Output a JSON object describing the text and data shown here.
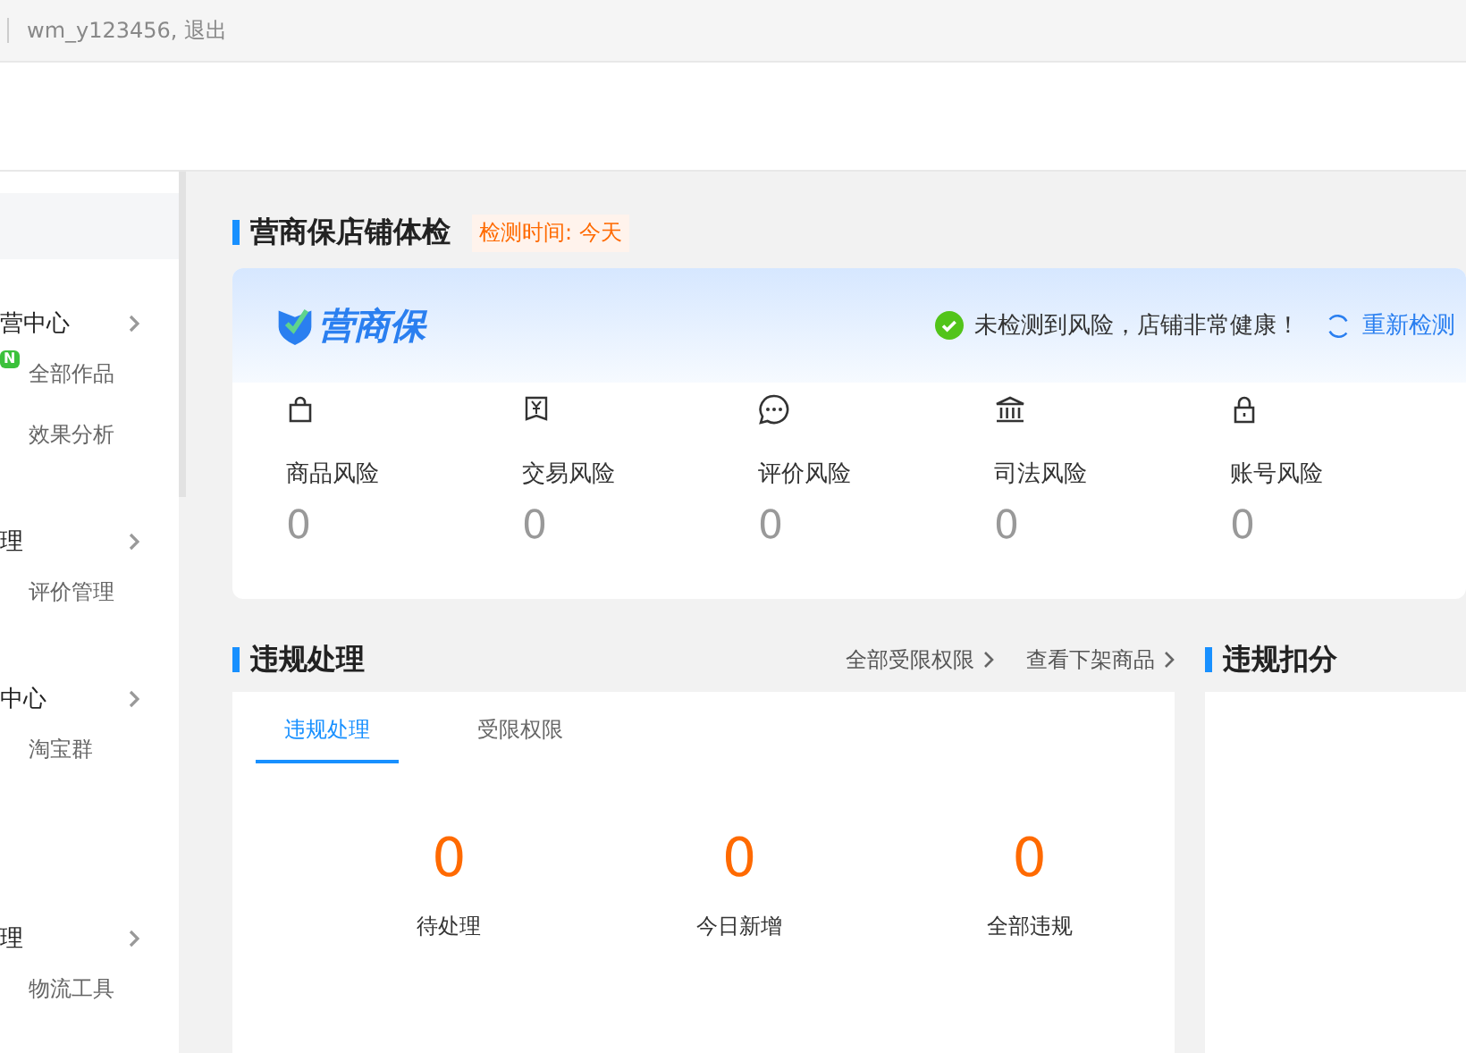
{
  "top_bar": {
    "user": "wm_y123456, 退出"
  },
  "sidebar": {
    "groups": [
      {
        "title": "营中心",
        "items": [
          {
            "label": "全部作品",
            "badge": "N"
          },
          {
            "label": "效果分析"
          }
        ]
      },
      {
        "title": "理",
        "items": [
          {
            "label": "评价管理"
          }
        ]
      },
      {
        "title": "中心",
        "items": [
          {
            "label": "淘宝群"
          }
        ]
      },
      {
        "title": "理",
        "items": [
          {
            "label": "物流工具"
          }
        ]
      }
    ]
  },
  "health_check": {
    "title": "营商保店铺体检",
    "check_time": "检测时间: 今天",
    "logo": "营商保",
    "status": "未检测到风险，店铺非常健康！",
    "recheck": "重新检测",
    "risks": [
      {
        "kind": "bag",
        "label": "商品风险",
        "value": "0"
      },
      {
        "kind": "yen",
        "label": "交易风险",
        "value": "0"
      },
      {
        "kind": "chat",
        "label": "评价风险",
        "value": "0"
      },
      {
        "kind": "court",
        "label": "司法风险",
        "value": "0"
      },
      {
        "kind": "lock",
        "label": "账号风险",
        "value": "0"
      }
    ]
  },
  "violations": {
    "title": "违规处理",
    "links": [
      "全部受限权限",
      "查看下架商品"
    ],
    "tabs": [
      {
        "label": "违规处理",
        "selected": true
      },
      {
        "label": "受限权限",
        "selected": false
      }
    ],
    "stats": [
      {
        "value": "0",
        "label": "待处理"
      },
      {
        "value": "0",
        "label": "今日新增"
      },
      {
        "value": "0",
        "label": "全部违规"
      }
    ]
  },
  "penalty": {
    "title": "违规扣分"
  }
}
